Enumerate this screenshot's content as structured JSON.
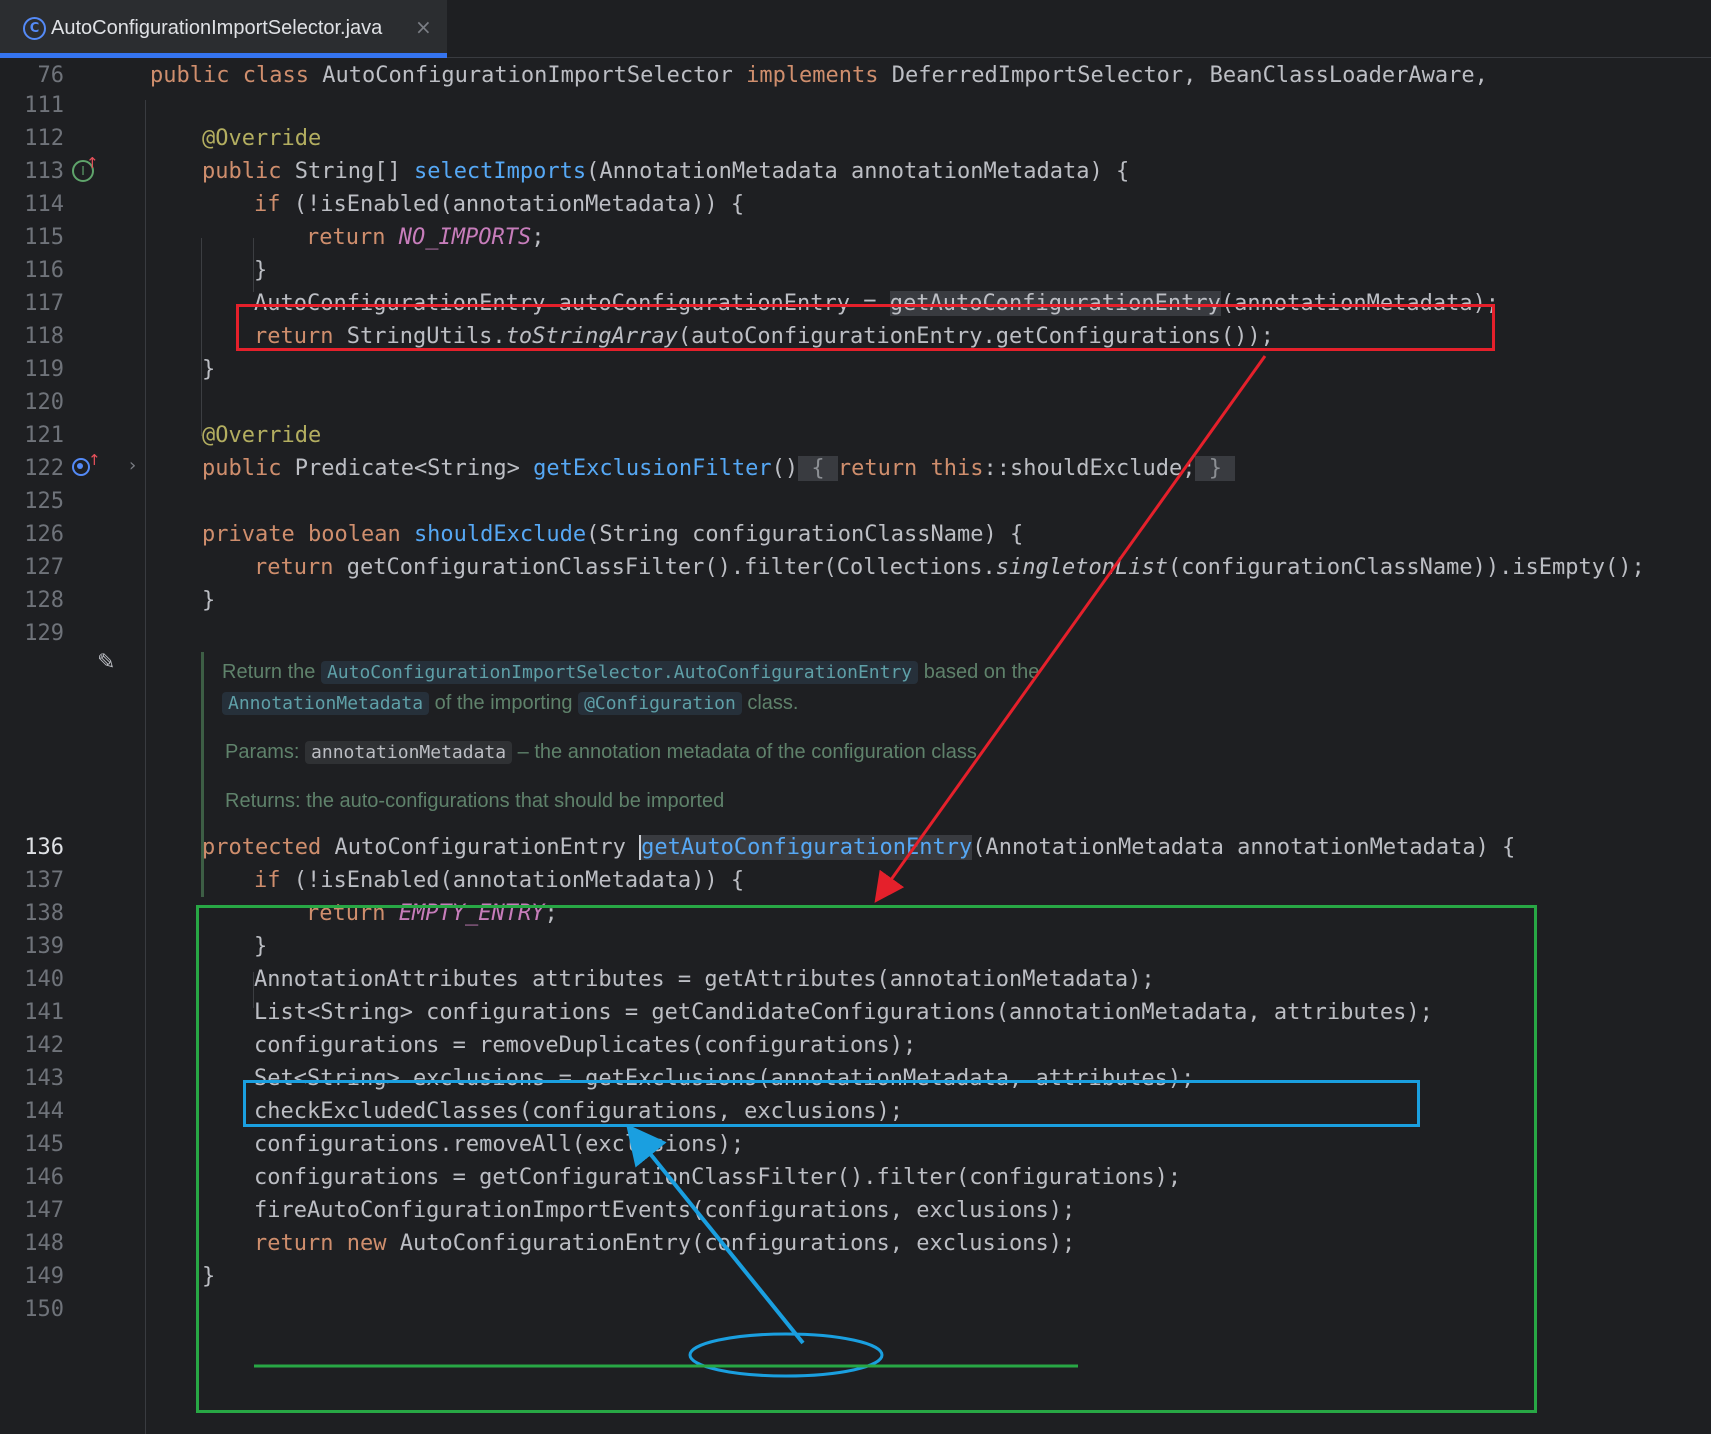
{
  "tab": {
    "filename": "AutoConfigurationImportSelector.java",
    "icon_letter": "C"
  },
  "lines": {
    "n76": "76",
    "n111": "111",
    "n112": "112",
    "n113": "113",
    "n114": "114",
    "n115": "115",
    "n116": "116",
    "n117": "117",
    "n118": "118",
    "n119": "119",
    "n120": "120",
    "n121": "121",
    "n122": "122",
    "n125": "125",
    "n126": "126",
    "n127": "127",
    "n128": "128",
    "n129": "129",
    "n136": "136",
    "n137": "137",
    "n138": "138",
    "n139": "139",
    "n140": "140",
    "n141": "141",
    "n142": "142",
    "n143": "143",
    "n144": "144",
    "n145": "145",
    "n146": "146",
    "n147": "147",
    "n148": "148",
    "n149": "149",
    "n150": "150"
  },
  "code": {
    "t": {
      "public": "public",
      "class": "class",
      "implements": "implements",
      "if": "if",
      "return": "return",
      "private": "private",
      "boolean": "boolean",
      "protected": "protected",
      "new": "new",
      "this": "this",
      "override": "@Override",
      "brace_open": "{",
      "brace_close": "}"
    },
    "l76_class": "AutoConfigurationImportSelector",
    "l76_rest": "DeferredImportSelector, BeanClassLoaderAware,",
    "l113_type": "String[]",
    "l113_fn": "selectImports",
    "l113_rest": "(AnnotationMetadata annotationMetadata) {",
    "l114_rest": "(!isEnabled(annotationMetadata)) {",
    "l115_const": "NO_IMPORTS",
    "semi": ";",
    "l117_a": "AutoConfigurationEntry autoConfigurationEntry = ",
    "l117_fn": "getAutoConfigurationEntry",
    "l117_b": "(annotationMetadata);",
    "l118_a": "StringUtils.",
    "l118_it": "toStringArray",
    "l118_b": "(autoConfigurationEntry.getConfigurations());",
    "l122_type": "Predicate<String>",
    "l122_fn": "getExclusionFilter",
    "l122_paren": "()",
    "l122_body": "::shouldExclude;",
    "l126_fn": "shouldExclude",
    "l126_rest": "(String configurationClassName) {",
    "l127_a": "getConfigurationClassFilter().filter(Collections.",
    "l127_it": "singletonList",
    "l127_b": "(configurationClassName)).isEmpty();",
    "l136_type": "AutoConfigurationEntry ",
    "l136_fn": "getAutoConfigurationEntry",
    "l136_rest": "(AnnotationMetadata annotationMetadata) {",
    "l137_rest": "(!isEnabled(annotationMetadata)) {",
    "l138_const": "EMPTY_ENTRY",
    "l140": "AnnotationAttributes attributes = getAttributes(annotationMetadata);",
    "l141": "List<String> configurations = getCandidateConfigurations(annotationMetadata, attributes);",
    "l142": "configurations = removeDuplicates(configurations);",
    "l143": "Set<String> exclusions = getExclusions(annotationMetadata, attributes);",
    "l144": "checkExcludedClasses(configurations, exclusions);",
    "l145": "configurations.removeAll(exclusions);",
    "l146": "configurations = getConfigurationClassFilter().filter(configurations);",
    "l147": "fireAutoConfigurationImportEvents(configurations, exclusions);",
    "l148_rest": "AutoConfigurationEntry(configurations, exclusions);"
  },
  "doc": {
    "return_the": "Return the",
    "ref1": "AutoConfigurationImportSelector.AutoConfigurationEntry",
    "based_on": "based on the",
    "ref2": "AnnotationMetadata",
    "of_importing": "of the importing",
    "ref3": "@Configuration",
    "class_end": "class.",
    "params_label": "Params:",
    "param_name": "annotationMetadata",
    "param_desc": "– the annotation metadata of the configuration class",
    "returns": "Returns: the auto-configurations that should be imported"
  },
  "icons": {
    "line113": "implementing-method-icon",
    "line122": "overriding-method-icon",
    "fold": "chevron-right-icon",
    "doc_edit": "pencil-icon"
  },
  "colors": {
    "red_annotation": "#e5202b",
    "green_annotation": "#28a745",
    "blue_annotation": "#1a9fe0"
  }
}
